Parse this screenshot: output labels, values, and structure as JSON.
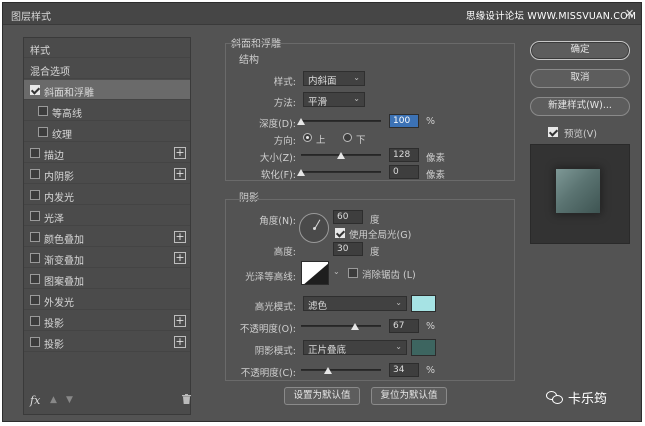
{
  "window": {
    "title": "图层样式",
    "watermark": "思缘设计论坛 WWW.MISSVUAN.COM",
    "close_glyph": "✕"
  },
  "sidebar": {
    "items": [
      {
        "label": "样式"
      },
      {
        "label": "混合选项"
      },
      {
        "label": "斜面和浮雕"
      },
      {
        "label": "等高线"
      },
      {
        "label": "纹理"
      },
      {
        "label": "描边"
      },
      {
        "label": "内阴影"
      },
      {
        "label": "内发光"
      },
      {
        "label": "光泽"
      },
      {
        "label": "颜色叠加"
      },
      {
        "label": "渐变叠加"
      },
      {
        "label": "图案叠加"
      },
      {
        "label": "外发光"
      },
      {
        "label": "投影"
      },
      {
        "label": "投影"
      }
    ],
    "plus_glyph": "+",
    "footer": {
      "fx": "fx",
      "up": "▲",
      "down": "▼",
      "trash": "🗑"
    }
  },
  "bevel": {
    "group_title": "斜面和浮雕",
    "structure_title": "结构",
    "style_label": "样式:",
    "style_value": "内斜面",
    "technique_label": "方法:",
    "technique_value": "平滑",
    "depth_label": "深度(D):",
    "depth_value": "100",
    "depth_unit": "%",
    "depth_level": 0,
    "direction_label": "方向:",
    "direction_up": "上",
    "direction_down": "下",
    "size_label": "大小(Z):",
    "size_value": "128",
    "size_unit": "像素",
    "size_level": 0.5,
    "soften_label": "软化(F):",
    "soften_value": "0",
    "soften_unit": "像素",
    "soften_level": 0
  },
  "shading": {
    "title": "阴影",
    "angle_label": "角度(N):",
    "angle_value": "60",
    "angle_unit": "度",
    "global_light_label": "使用全局光(G)",
    "altitude_label": "高度:",
    "altitude_value": "30",
    "altitude_unit": "度",
    "gloss_label": "光泽等高线:",
    "antialias_label": "消除锯齿 (L)",
    "highlight_label": "高光模式:",
    "highlight_value": "滤色",
    "highlight_color": "#a6e3e4",
    "highlight_opacity_label": "不透明度(O):",
    "highlight_opacity": "67",
    "highlight_level": 0.67,
    "shadow_label": "阴影模式:",
    "shadow_value": "正片叠底",
    "shadow_color": "#3d6560",
    "shadow_opacity_label": "不透明度(C):",
    "shadow_opacity": "34",
    "shadow_level": 0.34,
    "percent": "%"
  },
  "actions": {
    "ok": "确定",
    "cancel": "取消",
    "new_style": "新建样式(W)...",
    "preview": "预览(V)",
    "make_default": "设置为默认值",
    "reset_default": "复位为默认值"
  },
  "brand": {
    "name": "卡乐筠"
  }
}
